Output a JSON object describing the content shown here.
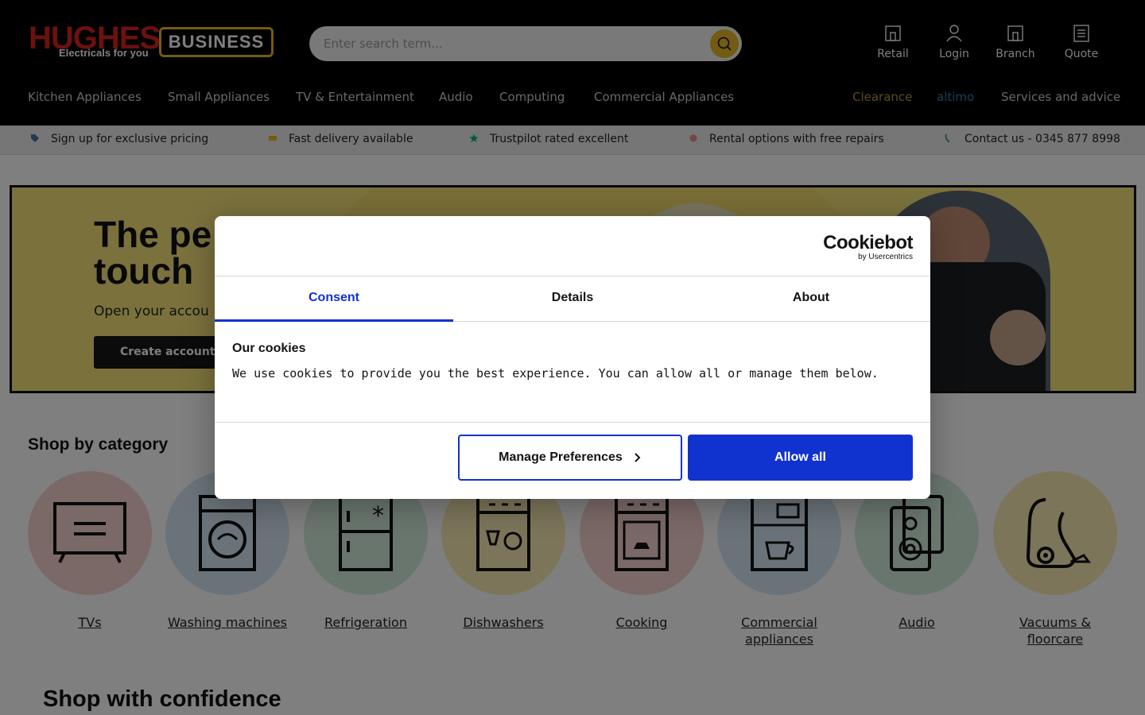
{
  "header": {
    "logo_brand": "HUGHES",
    "logo_tagline": "Electricals for you",
    "logo_business": "BUSINESS",
    "search_placeholder": "Enter search term...",
    "links": [
      {
        "label": "Retail",
        "icon": "store-icon"
      },
      {
        "label": "Login",
        "icon": "user-icon"
      },
      {
        "label": "Branch",
        "icon": "branch-icon"
      },
      {
        "label": "Quote",
        "icon": "quote-icon"
      }
    ],
    "nav": [
      "Kitchen Appliances",
      "Small Appliances",
      "TV & Entertainment",
      "Audio",
      "Computing",
      "Commercial Appliances"
    ],
    "nav_right": [
      "Clearance",
      "altimo",
      "Services and advice"
    ]
  },
  "usp": [
    {
      "text": "Sign up for exclusive pricing",
      "icon": "tag-icon"
    },
    {
      "text": "Fast delivery available",
      "icon": "delivery-icon"
    },
    {
      "text": "Trustpilot rated excellent",
      "icon": "star-icon"
    },
    {
      "text": "Rental options with free repairs",
      "icon": "rental-icon"
    },
    {
      "text": "Contact us - 0345 877 8998",
      "icon": "phone-icon"
    }
  ],
  "hero": {
    "title_line1": "The pe",
    "title_line2": "touch",
    "subtitle": "Open your accou",
    "button": "Create account"
  },
  "categories": {
    "title": "Shop by category",
    "items": [
      {
        "label": "TVs",
        "color": "#f6d3cf"
      },
      {
        "label": "Washing machines",
        "color": "#d5e6f2"
      },
      {
        "label": "Refrigeration",
        "color": "#d3ecdd"
      },
      {
        "label": "Dishwashers",
        "color": "#f8ebb4"
      },
      {
        "label": "Cooking",
        "color": "#f6d3cf"
      },
      {
        "label": "Commercial appliances",
        "color": "#d5e6f2"
      },
      {
        "label": "Audio",
        "color": "#d3ecdd"
      },
      {
        "label": "Vacuums & floorcare",
        "color": "#f8ebb4"
      }
    ]
  },
  "shop_confidence": "Shop with confidence",
  "cookie_dialog": {
    "brand": "Cookiebot",
    "brand_sub": "by Usercentrics",
    "tabs": [
      "Consent",
      "Details",
      "About"
    ],
    "active_tab": "Consent",
    "heading": "Our cookies",
    "text": "We use cookies to provide you the best experience. You can allow all or manage them below.",
    "manage_button": "Manage Preferences",
    "allow_button": "Allow all",
    "accent_color": "#1032cf"
  }
}
